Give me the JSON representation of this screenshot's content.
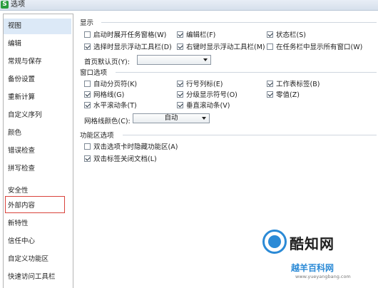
{
  "window": {
    "title": "选项",
    "icon": "S"
  },
  "sidebar": {
    "items": [
      {
        "label": "视图",
        "selected": true
      },
      {
        "label": "编辑"
      },
      {
        "label": "常规与保存"
      },
      {
        "label": "备份设置"
      },
      {
        "label": "重新计算"
      },
      {
        "label": "自定义序列"
      },
      {
        "label": "颜色"
      },
      {
        "label": "错误检查"
      },
      {
        "label": "拼写检查"
      },
      {
        "label": "安全性"
      },
      {
        "label": "外部内容"
      },
      {
        "label": "新特性"
      },
      {
        "label": "信任中心"
      },
      {
        "label": "自定义功能区"
      },
      {
        "label": "快速访问工具栏"
      }
    ]
  },
  "display": {
    "heading": "显示",
    "options": [
      {
        "label": "启动时展开任务窗格(W)",
        "checked": false
      },
      {
        "label": "编辑栏(F)",
        "checked": true
      },
      {
        "label": "状态栏(S)",
        "checked": true
      },
      {
        "label": "选择时显示浮动工具栏(D)",
        "checked": true
      },
      {
        "label": "右键时显示浮动工具栏(M)",
        "checked": true
      },
      {
        "label": "在任务栏中显示所有窗口(W)",
        "checked": false
      }
    ],
    "home_label": "首页默认页(Y):",
    "home_value": ""
  },
  "window_options": {
    "heading": "窗口选项",
    "options": [
      {
        "label": "自动分页符(K)",
        "checked": false
      },
      {
        "label": "行号列标(E)",
        "checked": true
      },
      {
        "label": "工作表标签(B)",
        "checked": true
      },
      {
        "label": "网格线(G)",
        "checked": true
      },
      {
        "label": "分级显示符号(O)",
        "checked": true
      },
      {
        "label": "零值(Z)",
        "checked": true
      },
      {
        "label": "水平滚动条(T)",
        "checked": true
      },
      {
        "label": "垂直滚动条(V)",
        "checked": true
      }
    ],
    "grid_color_label": "网格线颜色(C):",
    "grid_color_value": "自动"
  },
  "ribbon": {
    "heading": "功能区选项",
    "options": [
      {
        "label": "双击选项卡时隐藏功能区(A)",
        "checked": false
      },
      {
        "label": "双击标签关闭文档(L)",
        "checked": true
      }
    ]
  },
  "watermark": {
    "title": "酷知网",
    "sub": "越羊百科网",
    "url": "www.yueyangbang.com",
    "color": "#2b8ad6"
  }
}
